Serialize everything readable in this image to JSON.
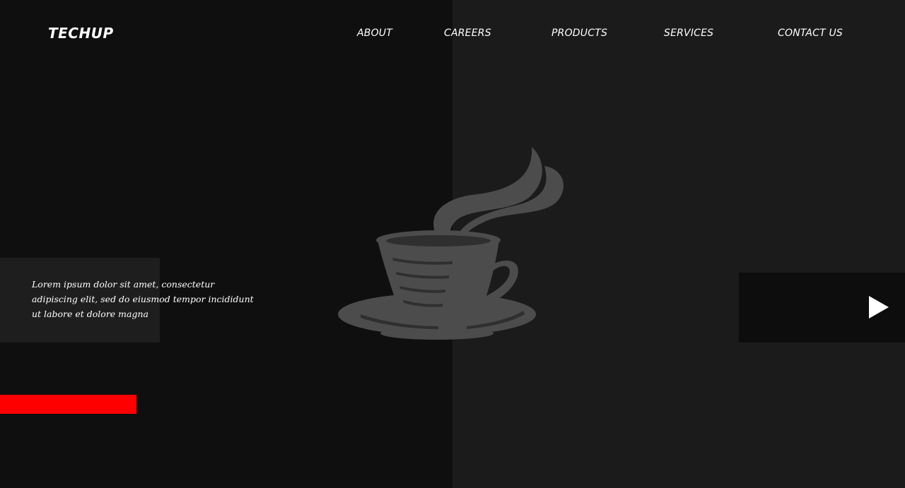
{
  "brand": {
    "logo_text": "TECHUP"
  },
  "nav": {
    "items": [
      {
        "label": "ABOUT"
      },
      {
        "label": "CAREERS"
      },
      {
        "label": "PRODUCTS"
      },
      {
        "label": "SERVICES"
      },
      {
        "label": "CONTACT US"
      }
    ]
  },
  "hero": {
    "lead_text": "Lorem ipsum dolor sit amet, consectetur adipiscing elit, sed do eiusmod tempor incididunt ut labore et dolore magna",
    "illustration": "coffee-cup-icon",
    "cta_icon": "play-icon"
  },
  "colors": {
    "background_left": "#0f0f0f",
    "background_right": "#1b1b1b",
    "accent": "#fe0000",
    "text": "#ffffff",
    "illustration": "#4d4c4c"
  }
}
